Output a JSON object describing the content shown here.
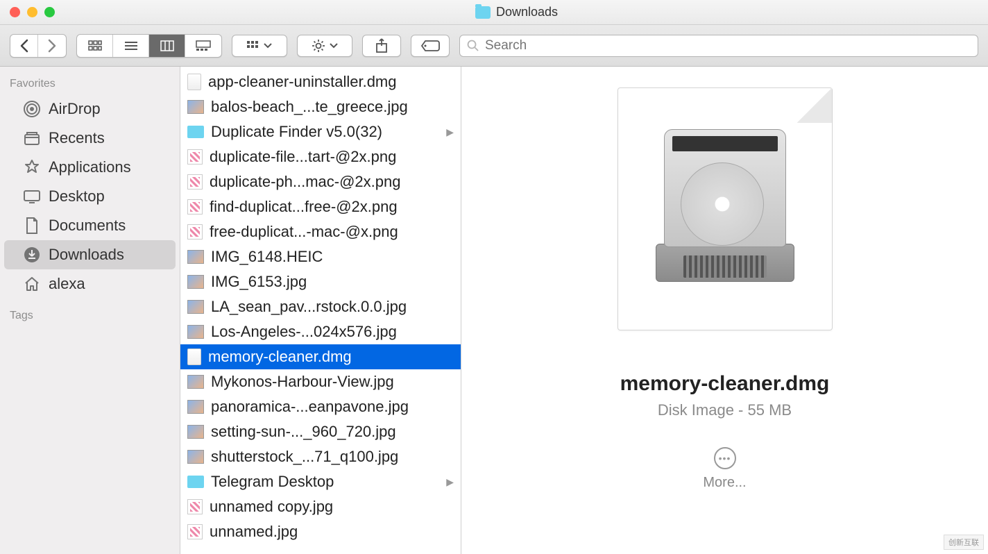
{
  "window": {
    "title": "Downloads"
  },
  "toolbar": {
    "search_placeholder": "Search"
  },
  "sidebar": {
    "favorites_label": "Favorites",
    "tags_label": "Tags",
    "items": [
      {
        "label": "AirDrop",
        "icon": "airdrop"
      },
      {
        "label": "Recents",
        "icon": "recents"
      },
      {
        "label": "Applications",
        "icon": "applications"
      },
      {
        "label": "Desktop",
        "icon": "desktop"
      },
      {
        "label": "Documents",
        "icon": "documents"
      },
      {
        "label": "Downloads",
        "icon": "downloads",
        "selected": true
      },
      {
        "label": "alexa",
        "icon": "home"
      }
    ]
  },
  "files": [
    {
      "name": "app-cleaner-uninstaller.dmg",
      "type": "dmg"
    },
    {
      "name": "balos-beach_...te_greece.jpg",
      "type": "jpg"
    },
    {
      "name": "Duplicate Finder v5.0(32)",
      "type": "folder",
      "expandable": true
    },
    {
      "name": "duplicate-file...tart-@2x.png",
      "type": "png"
    },
    {
      "name": "duplicate-ph...mac-@2x.png",
      "type": "png"
    },
    {
      "name": "find-duplicat...free-@2x.png",
      "type": "png"
    },
    {
      "name": "free-duplicat...-mac-@x.png",
      "type": "png"
    },
    {
      "name": "IMG_6148.HEIC",
      "type": "jpg"
    },
    {
      "name": "IMG_6153.jpg",
      "type": "jpg"
    },
    {
      "name": "LA_sean_pav...rstock.0.0.jpg",
      "type": "jpg"
    },
    {
      "name": "Los-Angeles-...024x576.jpg",
      "type": "jpg"
    },
    {
      "name": "memory-cleaner.dmg",
      "type": "dmg",
      "selected": true
    },
    {
      "name": "Mykonos-Harbour-View.jpg",
      "type": "jpg"
    },
    {
      "name": "panoramica-...eanpavone.jpg",
      "type": "jpg"
    },
    {
      "name": "setting-sun-..._960_720.jpg",
      "type": "jpg"
    },
    {
      "name": "shutterstock_...71_q100.jpg",
      "type": "jpg"
    },
    {
      "name": "Telegram Desktop",
      "type": "folder",
      "expandable": true
    },
    {
      "name": "unnamed copy.jpg",
      "type": "png"
    },
    {
      "name": "unnamed.jpg",
      "type": "png"
    }
  ],
  "preview": {
    "filename": "memory-cleaner.dmg",
    "kind": "Disk Image",
    "size": "55 MB",
    "more_label": "More..."
  },
  "watermark": "创新互联"
}
